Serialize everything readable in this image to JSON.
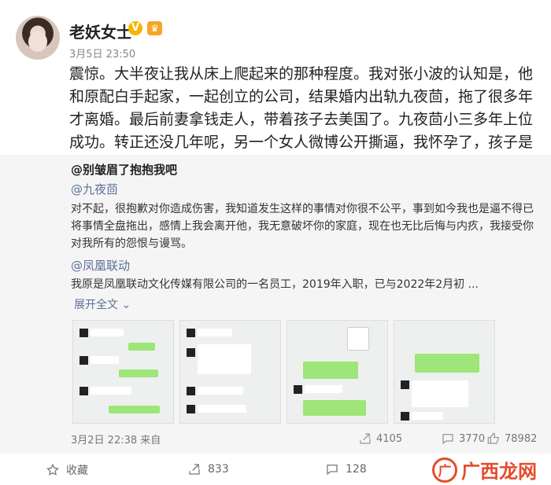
{
  "post": {
    "author": "老妖女士",
    "verified_icon": "gold-verified-badge",
    "vip_icon": "vip-badge",
    "time": "3月5日 23:50",
    "content": "震惊。大半夜让我从床上爬起来的那种程度。我对张小波的认知是，他和原配白手起家，一起创立的公司，结果婚内出轨九夜茴，拖了很多年才离婚。最后前妻拿钱走人，带着孩子去美国了。九夜茴小三多年上位成功。转正还没几年呢，另一个女人微博公开撕逼，我怀孕了，孩子是你老公的，你看看怎么解决吧。"
  },
  "repost": {
    "author": "@别皱眉了抱抱我吧",
    "mention_1": "@九夜茴",
    "text_1": "对不起，很抱歉对你造成伤害，我知道发生这样的事情对你很不公平，事到如今我也是逼不得已将事情全盘拖出，感情上我会离开他，我无意破坏你的家庭，现在也无比后悔与内疚，我接受你对我所有的怨恨与谩骂。",
    "mention_2": "@凤凰联动",
    "text_2": "我原是凤凰联动文化传媒有限公司的一名员工，2019年入职，已与2022年2月初 ...",
    "expand": "展开全文",
    "time": "3月2日 22:38 来自",
    "shares": "4105",
    "comments": "3770",
    "likes": "78982"
  },
  "footer": {
    "favorite": "收藏",
    "shares": "833",
    "comments": "128"
  },
  "watermark": {
    "logo": "广",
    "text": "广西龙网"
  }
}
